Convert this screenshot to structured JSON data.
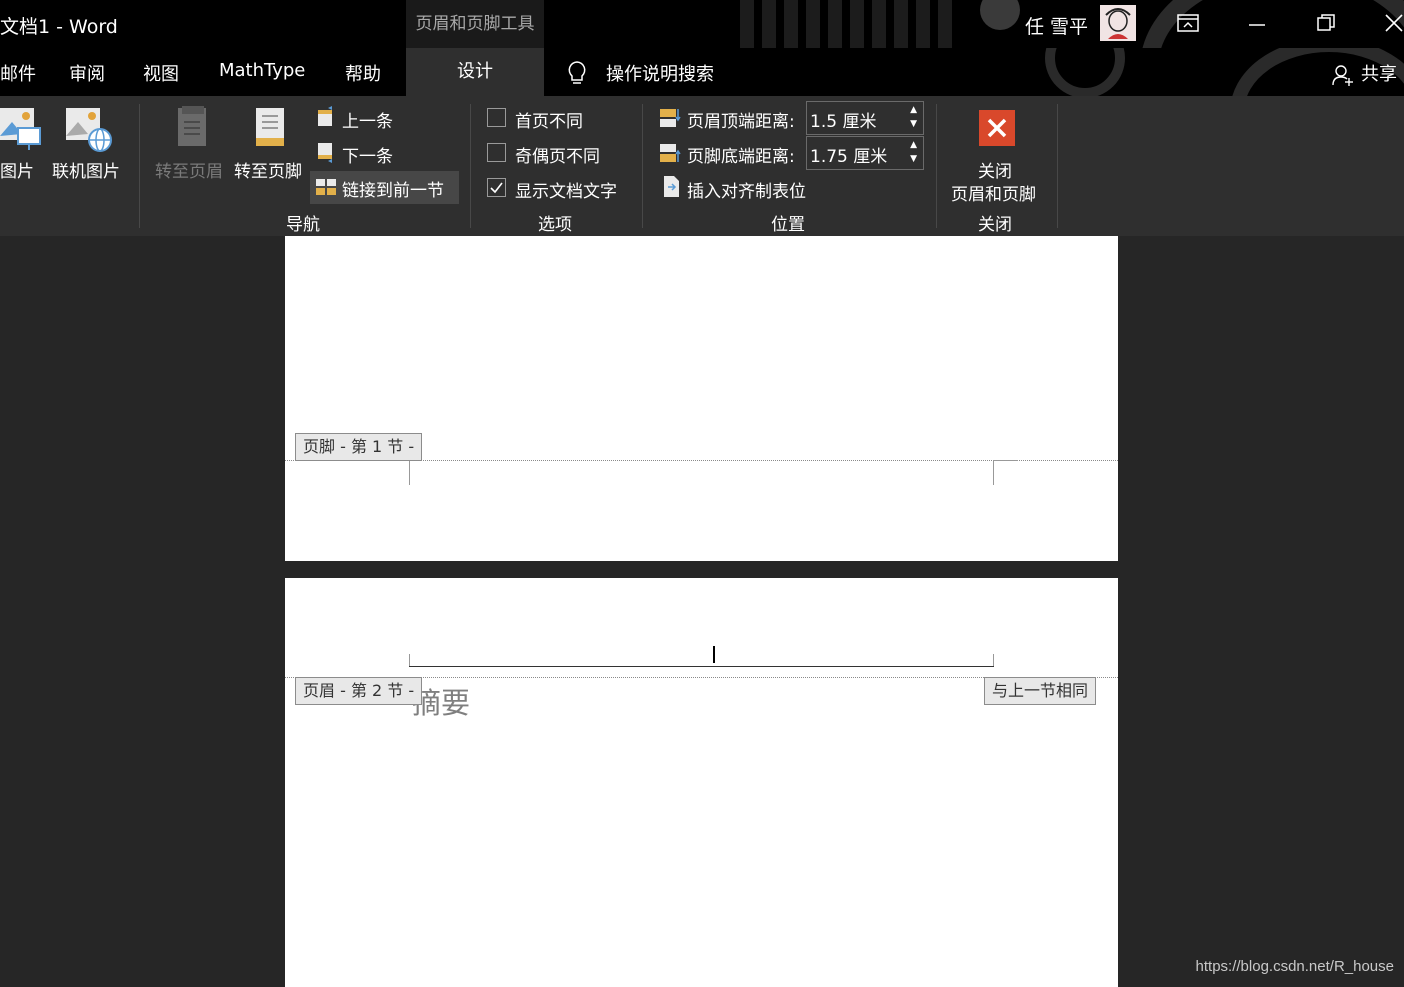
{
  "window": {
    "title": "文档1  -  Word",
    "context_tab_title": "页眉和页脚工具",
    "user_name": "任 雪平"
  },
  "tabs": {
    "items": [
      "邮件",
      "审阅",
      "视图",
      "MathType",
      "帮助"
    ],
    "items_visible": [
      "邮件",
      "审阅",
      "视图",
      "MathType",
      "帮助"
    ],
    "active": "设计",
    "search_label": "操作说明搜索",
    "share_label": "共享"
  },
  "ribbon": {
    "insert": {
      "pictures": "图片",
      "online_pictures": "联机图片"
    },
    "nav": {
      "goto_header": "转至页眉",
      "goto_footer": "转至页脚",
      "previous": "上一条",
      "next": "下一条",
      "link_previous": "链接到前一节",
      "group_label": "导航"
    },
    "options": {
      "different_first": "首页不同",
      "different_odd_even": "奇偶页不同",
      "show_doc_text": "显示文档文字",
      "different_first_checked": false,
      "different_odd_even_checked": false,
      "show_doc_text_checked": true,
      "group_label": "选项"
    },
    "position": {
      "header_from_top_label": "页眉顶端距离:",
      "header_from_top_value": "1.5 厘米",
      "footer_from_bottom_label": "页脚底端距离:",
      "footer_from_bottom_value": "1.75 厘米",
      "insert_alignment_tab": "插入对齐制表位",
      "group_label": "位置"
    },
    "close": {
      "line1": "关闭",
      "line2": "页眉和页脚",
      "group_label": "关闭",
      "accent": "#d9482b"
    }
  },
  "document": {
    "page1_footer_tag": "页脚 - 第 1 节 -",
    "page2_header_tag": "页眉 - 第 2 节 -",
    "same_as_previous": "与上一节相同",
    "body_text": "摘要"
  },
  "watermark": "https://blog.csdn.net/R_house"
}
